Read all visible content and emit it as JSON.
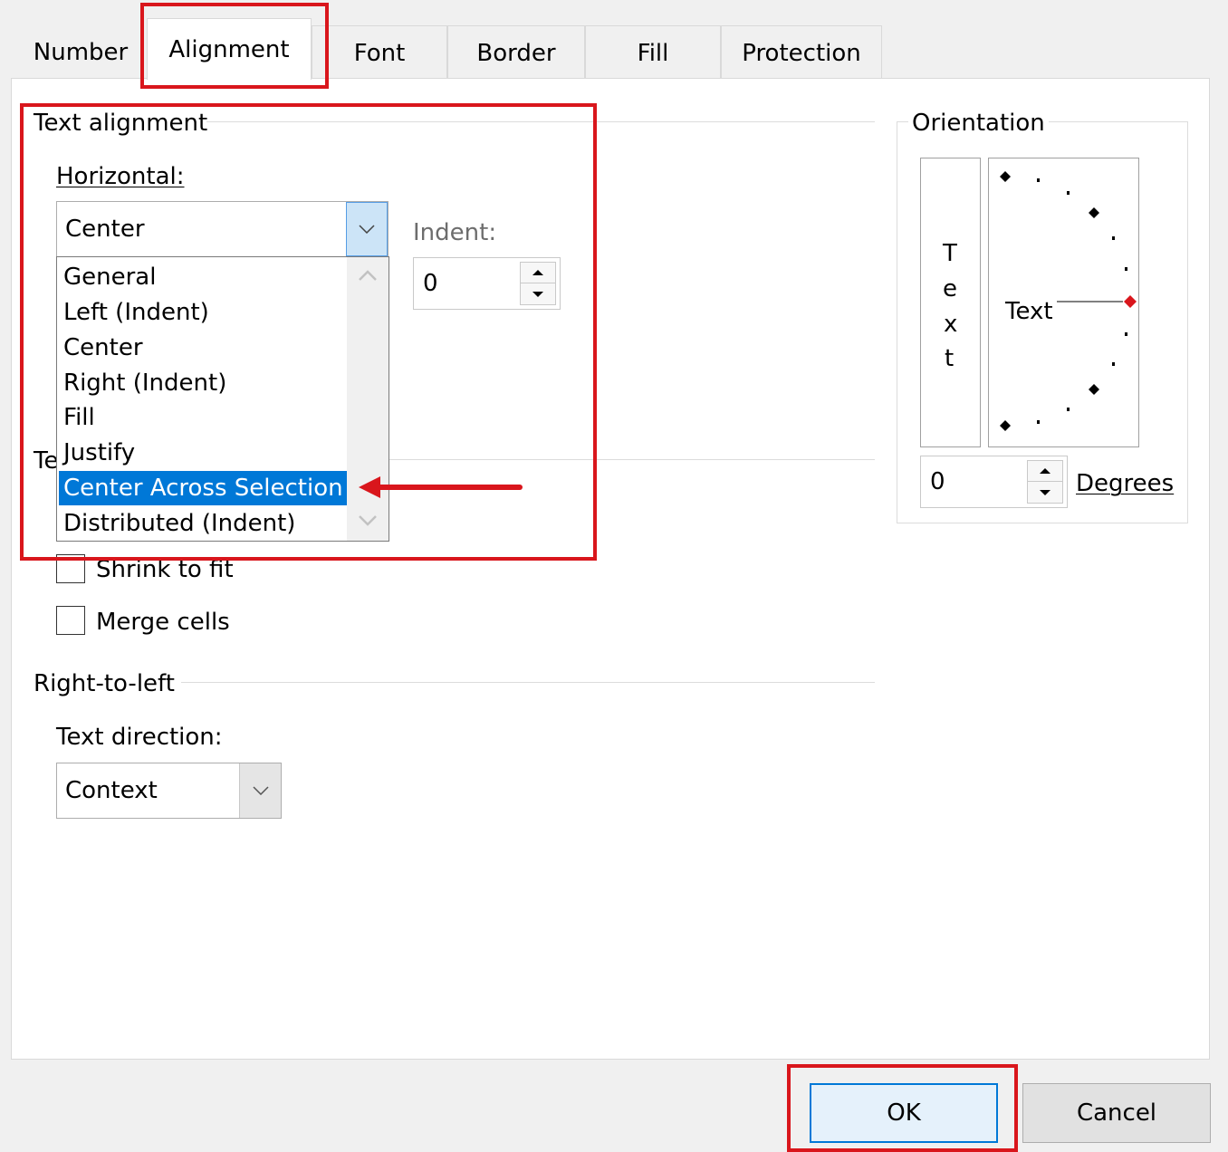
{
  "tabs": [
    {
      "label": "Number"
    },
    {
      "label": "Alignment"
    },
    {
      "label": "Font"
    },
    {
      "label": "Border"
    },
    {
      "label": "Fill"
    },
    {
      "label": "Protection"
    }
  ],
  "text_alignment": {
    "group_label": "Text alignment",
    "horizontal_label": "Horizontal:",
    "horizontal_value": "Center",
    "horizontal_options": [
      "General",
      "Left (Indent)",
      "Center",
      "Right (Indent)",
      "Fill",
      "Justify",
      "Center Across Selection",
      "Distributed (Indent)"
    ],
    "selected_option": "Center Across Selection",
    "indent_label": "Indent:",
    "indent_value": "0",
    "hidden_group_label_fragment": "Te"
  },
  "text_control": {
    "shrink_label": "Shrink to fit",
    "shrink_checked": false,
    "merge_label": "Merge cells",
    "merge_checked": false
  },
  "right_to_left": {
    "group_label": "Right-to-left",
    "direction_label": "Text direction:",
    "direction_value": "Context"
  },
  "orientation": {
    "group_label": "Orientation",
    "vertical_text": [
      "T",
      "e",
      "x",
      "t"
    ],
    "dial_text": "Text",
    "degrees_value": "0",
    "degrees_label": "Degrees"
  },
  "buttons": {
    "ok": "OK",
    "cancel": "Cancel"
  },
  "colors": {
    "highlight": "#0078d7",
    "annotation": "#d9161c",
    "dial_marker": "#d9161c"
  }
}
